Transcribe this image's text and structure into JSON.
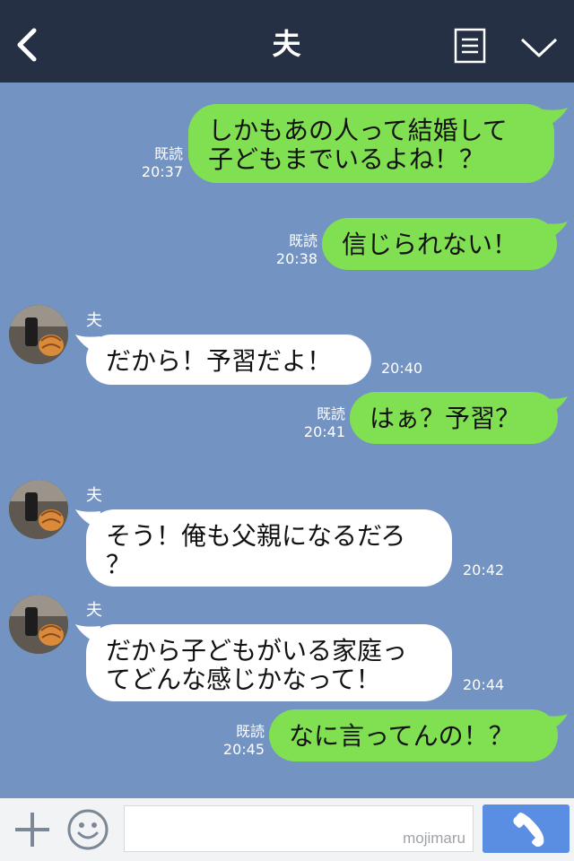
{
  "header": {
    "title": "夫"
  },
  "messages": [
    {
      "side": "right",
      "lines": [
        "しかもあの人って結婚して",
        "子どもまでいるよね！？"
      ],
      "read": "既読",
      "time": "20:37"
    },
    {
      "side": "right",
      "lines": [
        "信じられない！"
      ],
      "read": "既読",
      "time": "20:38"
    },
    {
      "side": "left",
      "sender": "夫",
      "lines": [
        "だから！予習だよ！"
      ],
      "time": "20:40"
    },
    {
      "side": "right",
      "lines": [
        "はぁ？予習？"
      ],
      "read": "既読",
      "time": "20:41"
    },
    {
      "side": "left",
      "sender": "夫",
      "lines": [
        "そう！俺も父親になるだろ",
        "？"
      ],
      "time": "20:42"
    },
    {
      "side": "left",
      "sender": "夫",
      "lines": [
        "だから子どもがいる家庭っ",
        "てどんな感じかなって！"
      ],
      "time": "20:44"
    },
    {
      "side": "right",
      "lines": [
        "なに言ってんの！？"
      ],
      "read": "既読",
      "time": "20:45"
    }
  ],
  "input": {
    "watermark": "mojimaru"
  },
  "colors": {
    "header": "#263045",
    "background": "#7393c2",
    "sent_bubble": "#81e052",
    "received_bubble": "#ffffff",
    "call_button": "#5a8ee3"
  },
  "icons": {
    "back": "chevron-left-icon",
    "menu": "list-icon",
    "collapse": "chevron-down-icon",
    "add": "plus-icon",
    "emoji": "smiley-icon",
    "call": "phone-icon"
  }
}
